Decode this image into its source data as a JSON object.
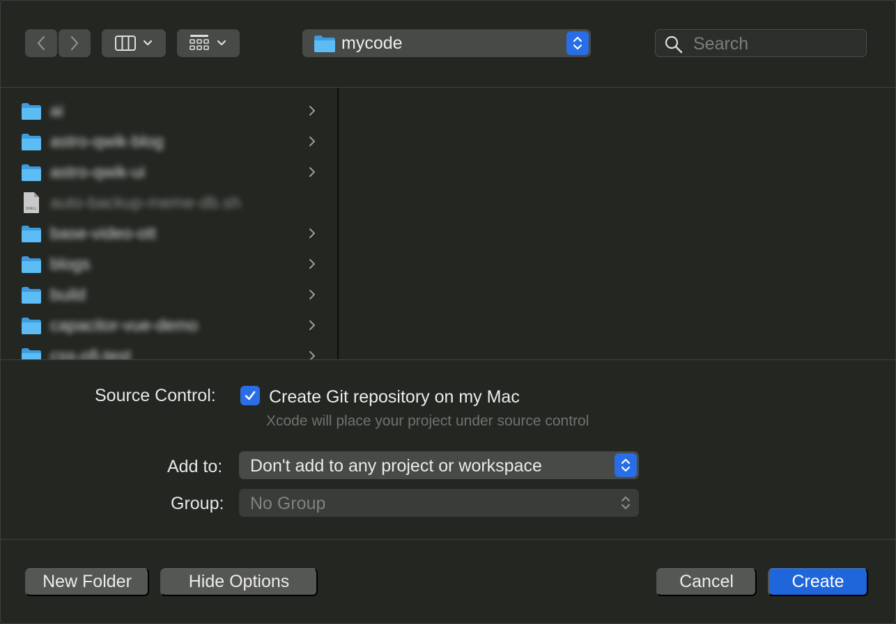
{
  "toolbar": {
    "back_icon": "chevron-left-icon",
    "forward_icon": "chevron-right-icon",
    "view_mode_icon": "columns-view-icon",
    "group_icon": "grid-view-icon",
    "path_label": "mycode",
    "search_placeholder": "Search"
  },
  "browser": {
    "items": [
      {
        "name": "ai",
        "type": "folder"
      },
      {
        "name": "astro-qwik-blog",
        "type": "folder"
      },
      {
        "name": "astro-qwik-ui",
        "type": "folder"
      },
      {
        "name": "auto-backup-meme-db.sh",
        "type": "shell-file"
      },
      {
        "name": "base-video-ott",
        "type": "folder"
      },
      {
        "name": "blogs",
        "type": "folder"
      },
      {
        "name": "build",
        "type": "folder"
      },
      {
        "name": "capacitor-vue-demo",
        "type": "folder"
      },
      {
        "name": "css-ofi-test",
        "type": "folder"
      }
    ]
  },
  "options": {
    "source_control_label": "Source Control:",
    "git_checkbox_label": "Create Git repository on my Mac",
    "git_checked": true,
    "git_hint": "Xcode will place your project under source control",
    "add_to_label": "Add to:",
    "add_to_value": "Don't add to any project or workspace",
    "group_label": "Group:",
    "group_value": "No Group"
  },
  "buttons": {
    "new_folder": "New Folder",
    "hide_options": "Hide Options",
    "cancel": "Cancel",
    "create": "Create"
  },
  "colors": {
    "accent": "#2a6ee6",
    "folder": "#4fb3f0",
    "background": "#232621"
  }
}
